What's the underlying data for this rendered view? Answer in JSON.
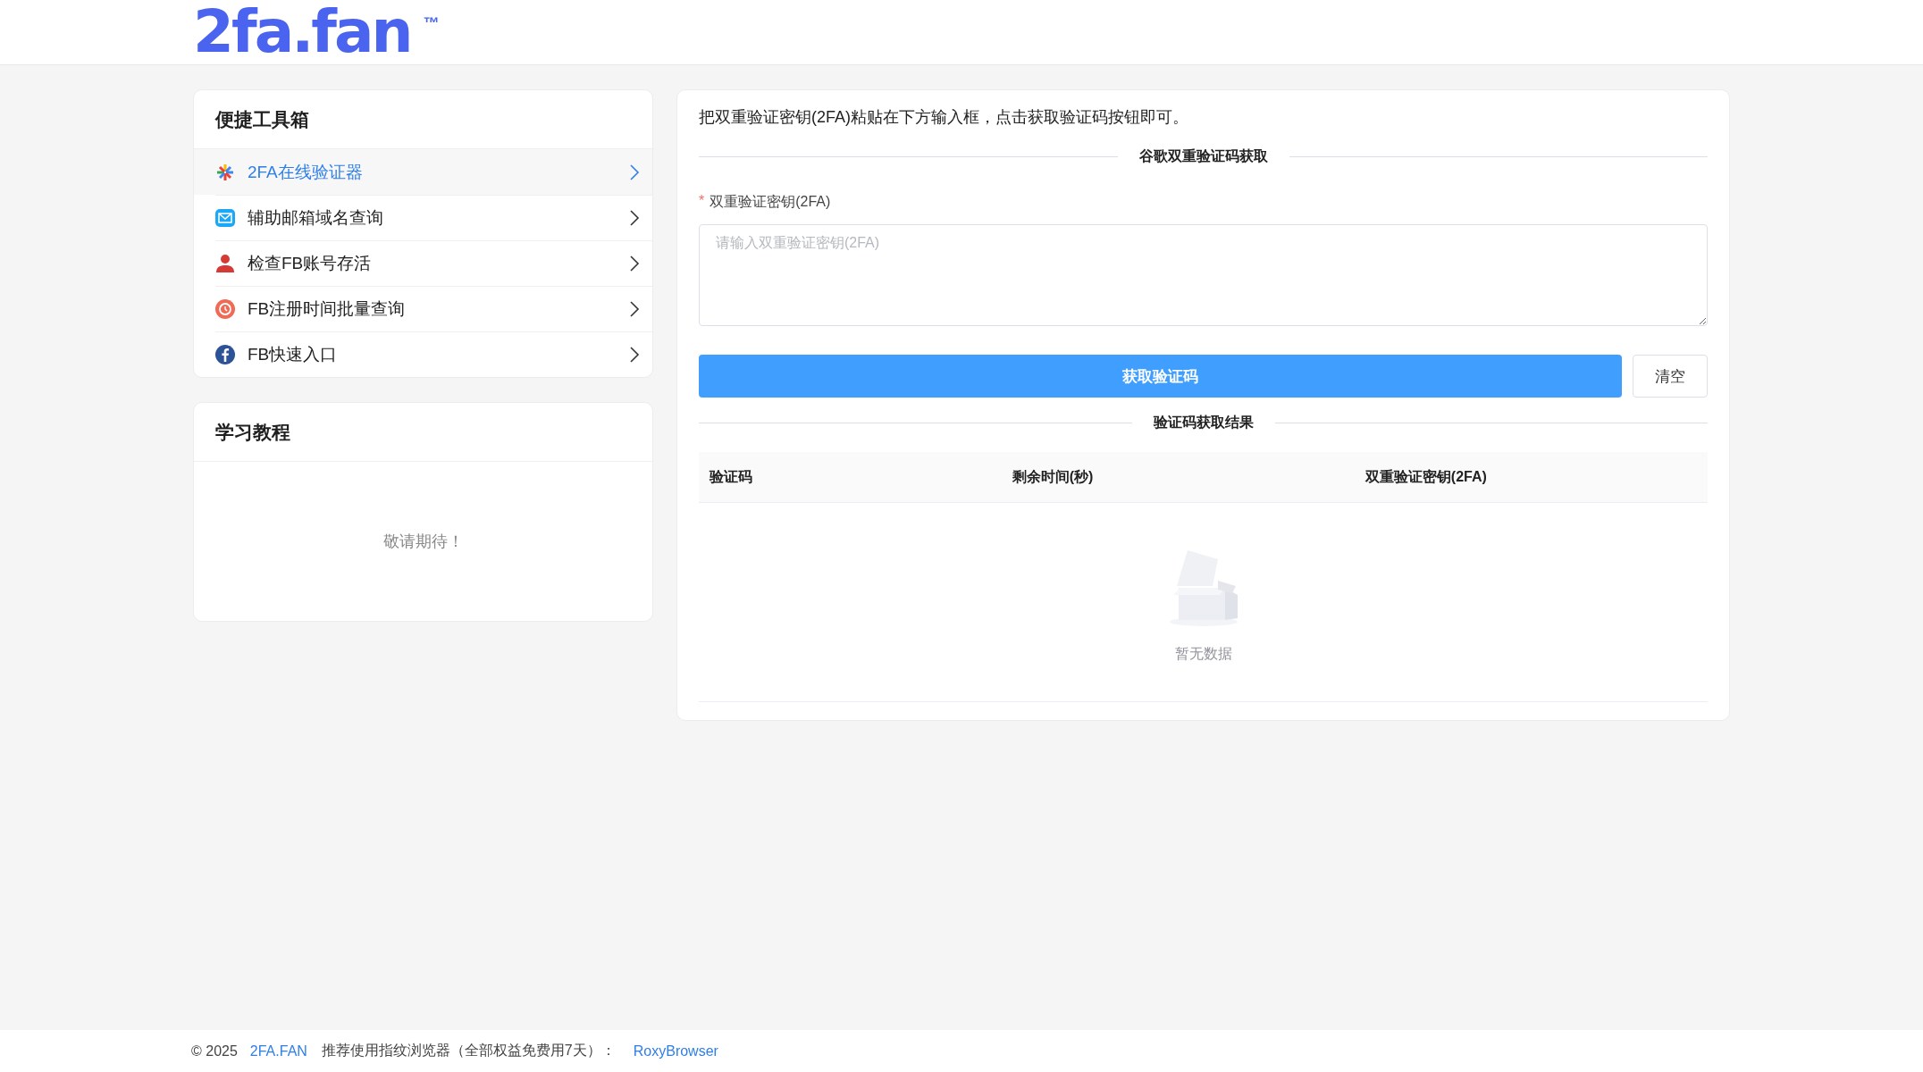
{
  "logo": {
    "text": "2fa.fan",
    "mark": "™"
  },
  "toolbox": {
    "title": "便捷工具箱",
    "items": [
      {
        "label": "2FA在线验证器",
        "kind": "authenticator",
        "selected": true
      },
      {
        "label": "辅助邮箱域名查询",
        "kind": "mail",
        "selected": false
      },
      {
        "label": "检查FB账号存活",
        "kind": "person",
        "selected": false
      },
      {
        "label": "FB注册时间批量查询",
        "kind": "clock",
        "selected": false
      },
      {
        "label": "FB快速入口",
        "kind": "facebook",
        "selected": false
      }
    ]
  },
  "tutorial": {
    "title": "学习教程",
    "empty_text": "敬请期待！"
  },
  "main": {
    "intro": "把双重验证密钥(2FA)粘贴在下方输入框，点击获取验证码按钮即可。",
    "section_title": "谷歌双重验证码获取",
    "field": {
      "required_mark": "*",
      "label": "双重验证密钥(2FA)",
      "placeholder": "请输入双重验证密钥(2FA)"
    },
    "buttons": [
      {
        "label": "获取验证码",
        "kind": "primary"
      },
      {
        "label": "清空",
        "kind": "default"
      }
    ],
    "result_title": "验证码获取结果",
    "table": {
      "columns": [
        "验证码",
        "剩余时间(秒)",
        "双重验证密钥(2FA)"
      ],
      "empty_text": "暂无数据"
    }
  },
  "footer": {
    "copyright": "© 2025",
    "site": "2FA.FAN",
    "promo": "推荐使用指纹浏览器（全部权益免费用7天）：",
    "link": "RoxyBrowser"
  }
}
